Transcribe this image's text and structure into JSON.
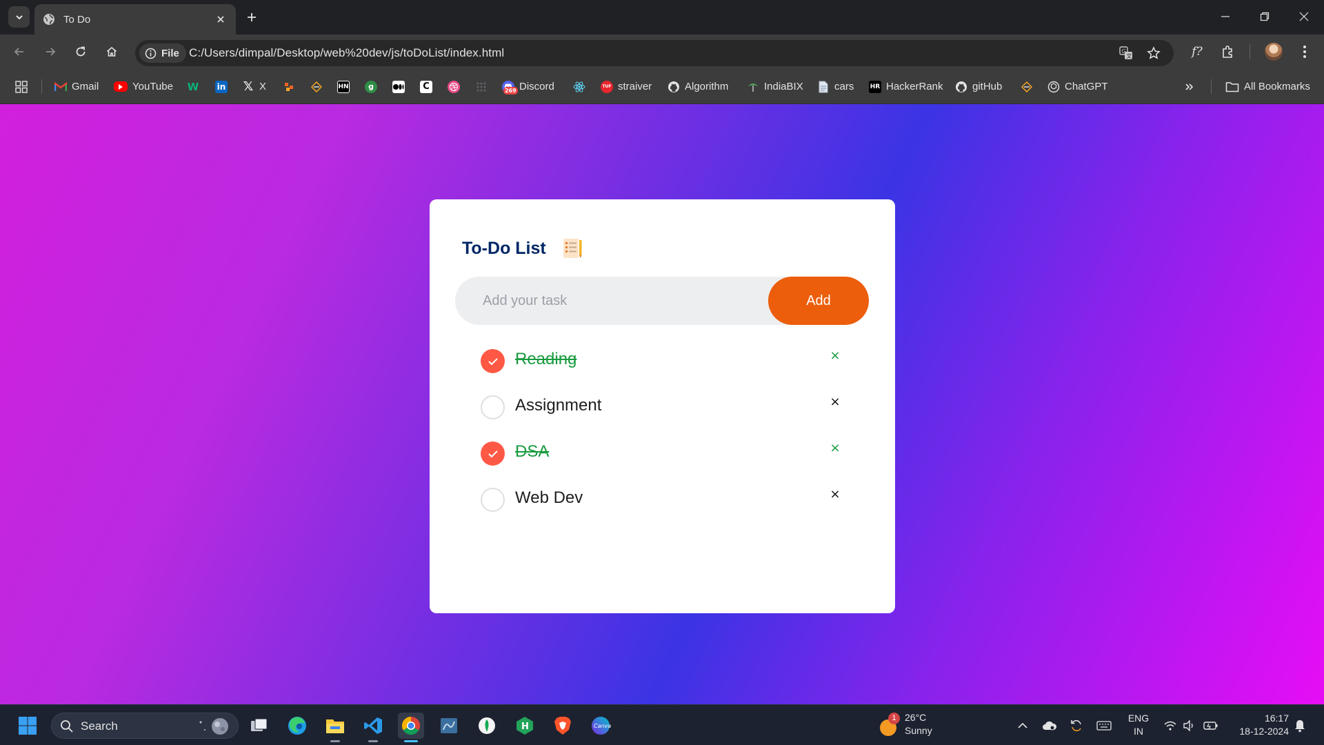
{
  "tab": {
    "title": "To Do"
  },
  "omnibox": {
    "scheme_label": "File",
    "url": "C:/Users/dimpal/Desktop/web%20dev/js/toDoList/index.html"
  },
  "bookmarks": {
    "items": [
      {
        "label": "Gmail",
        "icon": "gmail-icon"
      },
      {
        "label": "YouTube",
        "icon": "youtube-icon"
      },
      {
        "label": "",
        "icon": "wellfound-icon"
      },
      {
        "label": "",
        "icon": "linkedin-icon"
      },
      {
        "label": "X",
        "icon": "x-icon"
      },
      {
        "label": "",
        "icon": "grid-icon"
      },
      {
        "label": "",
        "icon": "layers-icon"
      },
      {
        "label": "",
        "icon": "hashnode-icon"
      },
      {
        "label": "",
        "icon": "gfg-icon"
      },
      {
        "label": "",
        "icon": "medium-icon"
      },
      {
        "label": "",
        "icon": "codechef-icon"
      },
      {
        "label": "",
        "icon": "dribbble-icon"
      },
      {
        "label": "",
        "icon": "apps-icon"
      },
      {
        "label": "Discord",
        "icon": "discord-icon",
        "badge": "269"
      },
      {
        "label": "",
        "icon": "react-icon"
      },
      {
        "label": "straiver",
        "icon": "tuf-icon",
        "badge": "TUF"
      },
      {
        "label": "Algorithm",
        "icon": "github-icon"
      },
      {
        "label": "IndiaBIX",
        "icon": "indiabix-icon"
      },
      {
        "label": "cars",
        "icon": "file-icon"
      },
      {
        "label": "HackerRank",
        "icon": "hackerrank-icon"
      },
      {
        "label": "gitHub",
        "icon": "github-icon"
      },
      {
        "label": "",
        "icon": "layers-icon"
      },
      {
        "label": "ChatGPT",
        "icon": "chatgpt-icon"
      }
    ],
    "all_bookmarks": "All Bookmarks"
  },
  "app": {
    "title": "To-Do List",
    "input_placeholder": "Add your task",
    "add_label": "Add",
    "tasks": [
      {
        "text": "Reading",
        "done": true
      },
      {
        "text": "Assignment",
        "done": false
      },
      {
        "text": "DSA",
        "done": true
      },
      {
        "text": "Web Dev",
        "done": false
      }
    ],
    "delete_glyph": "×"
  },
  "taskbar": {
    "search_label": "Search",
    "weather": {
      "temp": "26°C",
      "desc": "Sunny",
      "badge": "1"
    },
    "lang": {
      "line1": "ENG",
      "line2": "IN"
    },
    "clock": {
      "time": "16:17",
      "date": "18-12-2024"
    }
  },
  "colors": {
    "accent_orange": "#ec5e0c",
    "check_red": "#ff5945",
    "done_green": "#179a3d",
    "title_navy": "#002765"
  }
}
